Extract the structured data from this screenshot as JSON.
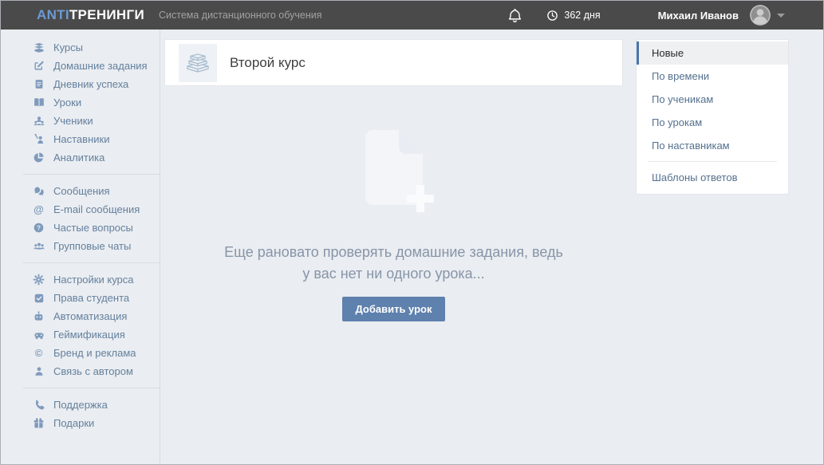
{
  "topbar": {
    "logo_primary": "ANTI",
    "logo_secondary": "ТРЕНИНГИ",
    "subtitle": "Система дистанционного обучения",
    "days_badge": "362 дня",
    "user_name": "Михаил Иванов"
  },
  "sidebar": {
    "group1": [
      "Курсы",
      "Домашние задания",
      "Дневник успеха",
      "Уроки",
      "Ученики",
      "Наставники",
      "Аналитика"
    ],
    "group2": [
      "Сообщения",
      "E-mail сообщения",
      "Частые вопросы",
      "Групповые чаты"
    ],
    "group3": [
      "Настройки курса",
      "Права студента",
      "Автоматизация",
      "Геймификация",
      "Бренд и реклама",
      "Связь с автором"
    ],
    "group4": [
      "Поддержка",
      "Подарки"
    ]
  },
  "main": {
    "course_title": "Второй курс",
    "empty_message_line1": "Еще рановато проверять домашние задания, ведь",
    "empty_message_line2": "у вас нет ни одного урока...",
    "add_lesson_button": "Добавить урок"
  },
  "right_panel": {
    "items": [
      "Новые",
      "По времени",
      "По ученикам",
      "По урокам",
      "По наставникам"
    ],
    "selected_item": "Новые",
    "templates_item": "Шаблоны ответов"
  },
  "colors": {
    "topbar_bg": "#4a4a4a",
    "logo_accent": "#6d9bd3",
    "page_bg": "#eaedf1",
    "sidebar_text": "#64809e",
    "sidebar_icon": "#7e9abc",
    "button_bg": "#5e81ad",
    "selected_border": "#4a76a8",
    "empty_text": "#8795a8"
  }
}
